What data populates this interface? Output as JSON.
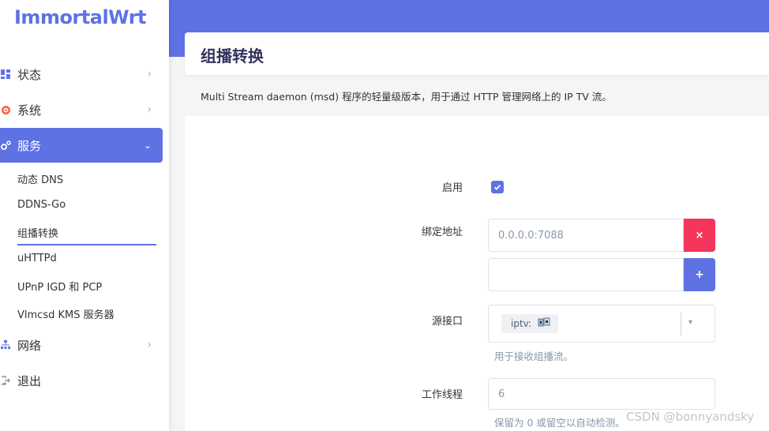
{
  "brand": {
    "logo": "ImmortalWrt"
  },
  "sidebar": {
    "items": [
      {
        "label": "状态",
        "icon": "dashboard-icon"
      },
      {
        "label": "系统",
        "icon": "gear-icon"
      },
      {
        "label": "服务",
        "icon": "services-icon"
      },
      {
        "label": "网络",
        "icon": "network-icon"
      },
      {
        "label": "退出",
        "icon": "logout-icon"
      }
    ],
    "sub_items": [
      {
        "label": "动态 DNS"
      },
      {
        "label": "DDNS-Go"
      },
      {
        "label": "组播转换"
      },
      {
        "label": "uHTTPd"
      },
      {
        "label": "UPnP IGD 和 PCP"
      },
      {
        "label": "Vlmcsd KMS 服务器"
      }
    ]
  },
  "page": {
    "title": "组播转换",
    "description": "Multi Stream daemon (msd) 程序的轻量级版本，用于通过 HTTP 管理网络上的 IP TV 流。"
  },
  "form": {
    "enable_label": "启用",
    "enable_checked": true,
    "bind_label": "绑定地址",
    "bind_values": [
      {
        "value": "0.0.0.0:7088",
        "button": "×"
      },
      {
        "value": "",
        "button": "+"
      }
    ],
    "source_label": "源接口",
    "source_tag": "iptv:",
    "source_caret": "▾",
    "source_help": "用于接收组播流。",
    "threads_label": "工作线程",
    "threads_value": "6",
    "threads_help": "保留为 0 或留空以自动检测。"
  },
  "watermark": "CSDN @bonnyandsky",
  "colors": {
    "accent": "#5e72e4",
    "danger": "#f5365c"
  }
}
